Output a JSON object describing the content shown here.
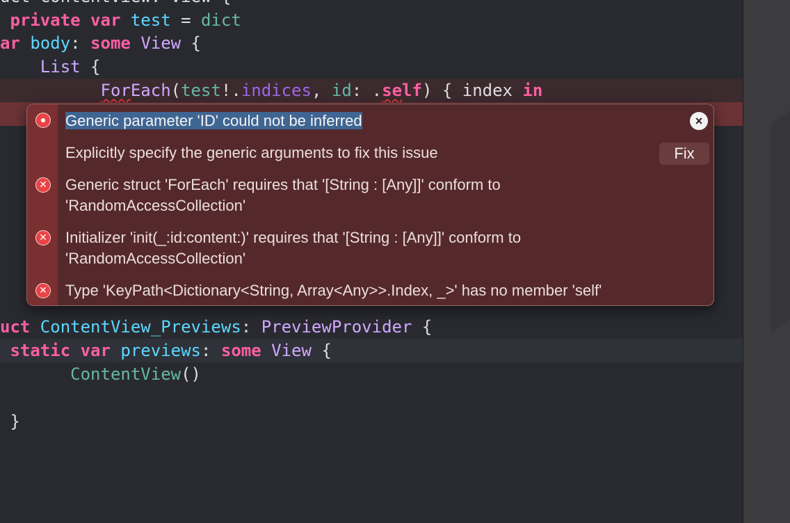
{
  "code_lines": [
    {
      "name": "line-struct-header",
      "tokens": [
        {
          "t": "uct ContentView: View {",
          "c": "plain"
        }
      ]
    },
    {
      "name": "line-private-var",
      "tokens": [
        {
          "t": " private var ",
          "c": "kw"
        },
        {
          "t": "test",
          "c": "tp-dec"
        },
        {
          "t": " = ",
          "c": "plain"
        },
        {
          "t": "dict",
          "c": "fn"
        }
      ]
    },
    {
      "name": "line-body",
      "tokens": [
        {
          "t": "ar ",
          "c": "kw"
        },
        {
          "t": "body",
          "c": "tp-dec"
        },
        {
          "t": ": ",
          "c": "plain"
        },
        {
          "t": "some ",
          "c": "kw"
        },
        {
          "t": "View",
          "c": "tp"
        },
        {
          "t": " {",
          "c": "plain"
        }
      ]
    },
    {
      "name": "line-list",
      "tokens": [
        {
          "t": "    ",
          "c": "plain"
        },
        {
          "t": "List",
          "c": "tp"
        },
        {
          "t": " {",
          "c": "plain"
        }
      ]
    },
    {
      "name": "line-foreach",
      "tokens": [
        {
          "t": "          ",
          "c": "plain"
        },
        {
          "t": "For",
          "c": "tp",
          "u": true
        },
        {
          "t": "Each",
          "c": "tp"
        },
        {
          "t": "(",
          "c": "plain"
        },
        {
          "t": "test",
          "c": "fn"
        },
        {
          "t": "!.",
          "c": "plain"
        },
        {
          "t": "indices",
          "c": "fn2"
        },
        {
          "t": ", ",
          "c": "plain"
        },
        {
          "t": "id",
          "c": "fn"
        },
        {
          "t": ": .",
          "c": "plain"
        },
        {
          "t": "se",
          "c": "kw",
          "u": true
        },
        {
          "t": "lf",
          "c": "kw"
        },
        {
          "t": ") { index ",
          "c": "plain"
        },
        {
          "t": "in",
          "c": "kw"
        }
      ]
    },
    {
      "name": "line-previews-struct",
      "tokens": [
        {
          "t": "uct ",
          "c": "kw"
        },
        {
          "t": "ContentView_Previews",
          "c": "tp-dec"
        },
        {
          "t": ": ",
          "c": "plain"
        },
        {
          "t": "PreviewProvider",
          "c": "tp"
        },
        {
          "t": " {",
          "c": "plain"
        }
      ]
    },
    {
      "name": "line-static-var",
      "tokens": [
        {
          "t": " static var ",
          "c": "kw"
        },
        {
          "t": "previews",
          "c": "tp-dec"
        },
        {
          "t": ": ",
          "c": "plain"
        },
        {
          "t": "some ",
          "c": "kw"
        },
        {
          "t": "View",
          "c": "tp"
        },
        {
          "t": " {",
          "c": "plain"
        }
      ]
    },
    {
      "name": "line-contentview-call",
      "tokens": [
        {
          "t": "       ",
          "c": "plain"
        },
        {
          "t": "ContentView",
          "c": "fn"
        },
        {
          "t": "()",
          "c": "plain"
        }
      ]
    },
    {
      "name": "line-blank",
      "tokens": []
    },
    {
      "name": "line-closing-brace",
      "tokens": [
        {
          "t": " }",
          "c": "plain"
        }
      ]
    }
  ],
  "popover": {
    "close_label": "×",
    "fix_label": "Fix",
    "messages": [
      {
        "kind": "error-primary",
        "text": "Generic parameter 'ID' could not be inferred"
      },
      {
        "kind": "fixit",
        "text": "Explicitly specify the generic arguments to fix this issue"
      },
      {
        "kind": "error",
        "line1": "Generic struct 'ForEach' requires that '[String : [Any]]' conform to",
        "line2": "'RandomAccessCollection'"
      },
      {
        "kind": "error",
        "line1": "Initializer 'init(_:id:content:)' requires that '[String : [Any]]' conform to",
        "line2": "'RandomAccessCollection'"
      },
      {
        "kind": "error",
        "line1": "Type 'KeyPath<Dictionary<String, Array<Any>>.Index, _>' has no member 'self'"
      }
    ]
  },
  "icons": {
    "error": "error-x-icon",
    "primary": "error-dot-icon",
    "close": "close-icon"
  }
}
